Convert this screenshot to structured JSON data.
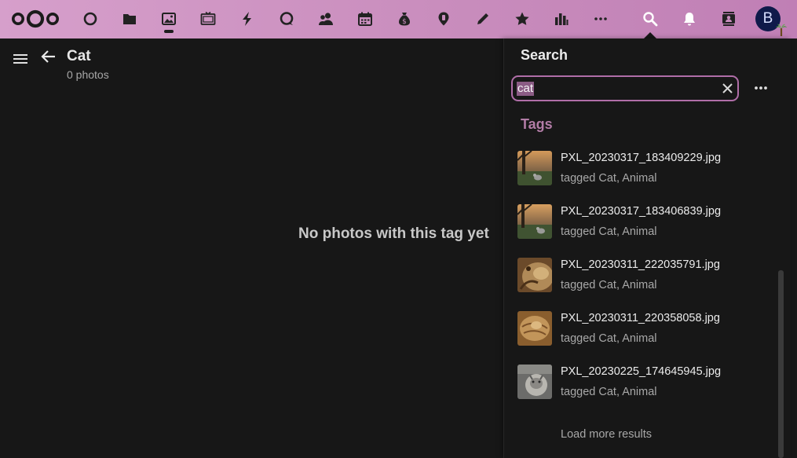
{
  "header": {
    "apps": [
      {
        "name": "dashboard-icon"
      },
      {
        "name": "files-icon"
      },
      {
        "name": "photos-icon"
      },
      {
        "name": "memories-icon"
      },
      {
        "name": "activity-icon"
      },
      {
        "name": "talk-icon"
      },
      {
        "name": "contacts-icon"
      },
      {
        "name": "calendar-icon"
      },
      {
        "name": "cospend-icon"
      },
      {
        "name": "maps-icon"
      },
      {
        "name": "notes-icon"
      },
      {
        "name": "favorites-icon"
      },
      {
        "name": "analytics-icon"
      },
      {
        "name": "more-apps-icon"
      }
    ],
    "avatar_initial": "B",
    "accent_color": "#c98dbd"
  },
  "main": {
    "title": "Cat",
    "subtitle": "0 photos",
    "empty_message": "No photos with this tag yet"
  },
  "search": {
    "title": "Search",
    "query": "cat",
    "section": "Tags",
    "results": [
      {
        "name": "PXL_20230317_183409229.jpg",
        "subtitle": "tagged Cat, Animal",
        "thumb": "tree-dusk"
      },
      {
        "name": "PXL_20230317_183406839.jpg",
        "subtitle": "tagged Cat, Animal",
        "thumb": "tree-dusk"
      },
      {
        "name": "PXL_20230311_222035791.jpg",
        "subtitle": "tagged Cat, Animal",
        "thumb": "cat-fur"
      },
      {
        "name": "PXL_20230311_220358058.jpg",
        "subtitle": "tagged Cat, Animal",
        "thumb": "cat-fur"
      },
      {
        "name": "PXL_20230225_174645945.jpg",
        "subtitle": "tagged Cat, Animal",
        "thumb": "cat-grey"
      }
    ],
    "load_more": "Load more results"
  }
}
